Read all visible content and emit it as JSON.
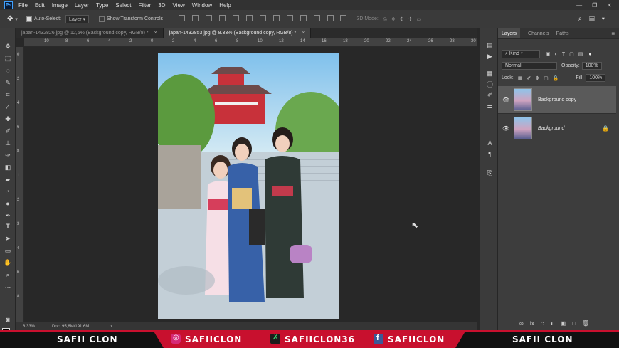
{
  "app": {
    "logo": "Ps",
    "menu": [
      "File",
      "Edit",
      "Image",
      "Layer",
      "Type",
      "Select",
      "Filter",
      "3D",
      "View",
      "Window",
      "Help"
    ],
    "window_controls": [
      "—",
      "❐",
      "✕"
    ]
  },
  "options_bar": {
    "auto_select_label": "Auto-Select:",
    "auto_select_value": "Layer",
    "transform_label": "Show Transform Controls",
    "mode_3d_label": "3D Mode:"
  },
  "tabs": [
    {
      "label": "japan-1432826.jpg @ 12,5% (Background copy, RGB/8) *",
      "close": "×"
    },
    {
      "label": "japan-1432853.jpg @ 8.33% (Background copy, RGB/8) *",
      "close": "×"
    }
  ],
  "ruler_top": [
    "10",
    "8",
    "6",
    "4",
    "2",
    "0",
    "2",
    "4",
    "6",
    "8",
    "10",
    "12",
    "14",
    "16",
    "18",
    "20",
    "22",
    "24",
    "26",
    "28",
    "30"
  ],
  "ruler_left": [
    "0",
    "2",
    "4",
    "6",
    "8",
    "1",
    "2",
    "3",
    "4",
    "6",
    "8"
  ],
  "status": {
    "zoom": "8,33%",
    "doc": "Doc: 95,8M/191,6M",
    "arrow": "›"
  },
  "layers_panel": {
    "tabs": [
      "Layers",
      "Channels",
      "Paths"
    ],
    "filter_label": "Kind",
    "blend_mode": "Normal",
    "opacity_label": "Opacity:",
    "opacity_value": "100%",
    "lock_label": "Lock:",
    "fill_label": "Fill:",
    "fill_value": "100%",
    "layers": [
      {
        "name": "Background copy",
        "selected": true
      },
      {
        "name": "Background",
        "selected": false
      }
    ],
    "footer_icons": [
      "∞",
      "fx",
      "◘",
      "◐",
      "▣",
      "□",
      "🗑"
    ]
  },
  "footer": {
    "left_name": "SAFII CLON",
    "instagram": "SAFIICLON",
    "other": "SAFIICLON36",
    "facebook": "SAFIICLON",
    "right_name": "SAFII CLON"
  },
  "colors": {
    "accent": "#31a8ff",
    "banner_red": "#c8102e",
    "fg": "#000000",
    "bg": "#ffffff"
  }
}
